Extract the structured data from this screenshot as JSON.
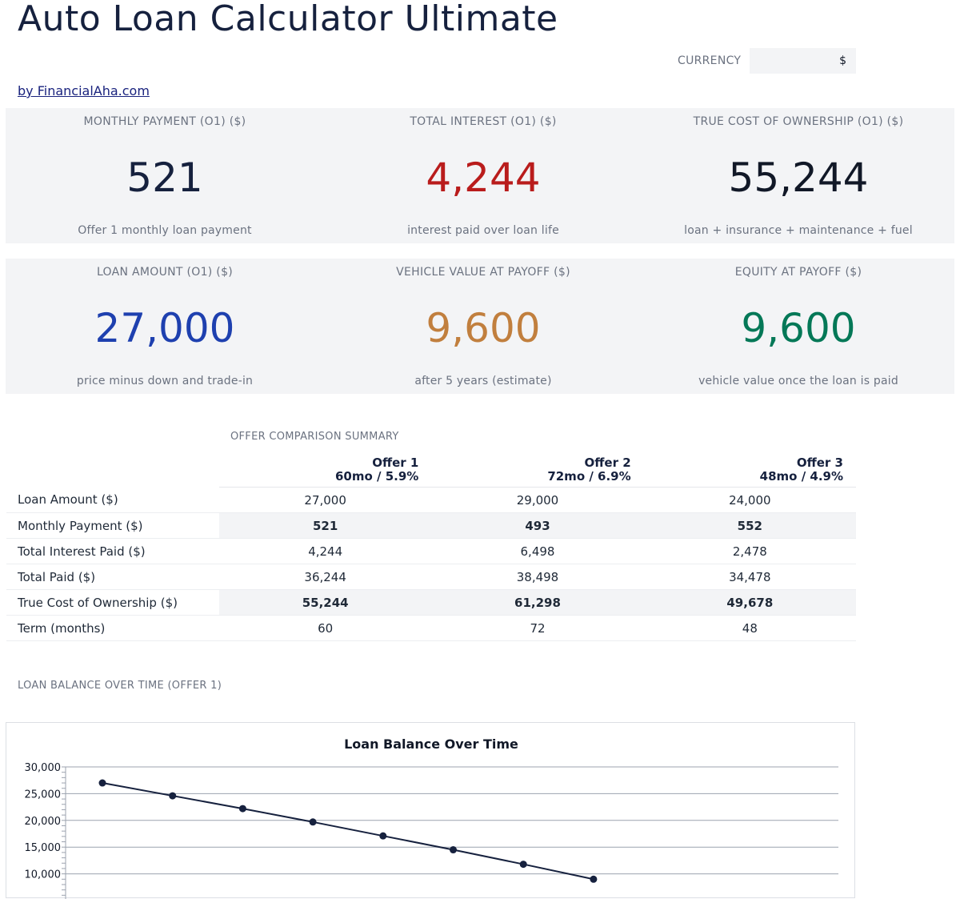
{
  "header": {
    "title": "Auto Loan Calculator Ultimate",
    "byline": "by FinancialAha.com",
    "currency_label": "CURRENCY",
    "currency_value": "$"
  },
  "kpis_row1": [
    {
      "label": "MONTHLY PAYMENT (O1) ($)",
      "value": "521",
      "sub": "Offer 1 monthly loan payment",
      "color": "#16213e"
    },
    {
      "label": "TOTAL INTEREST (O1) ($)",
      "value": "4,244",
      "sub": "interest paid over loan life",
      "color": "#b91c1c"
    },
    {
      "label": "TRUE COST OF OWNERSHIP (O1) ($)",
      "value": "55,244",
      "sub": "loan + insurance + maintenance + fuel",
      "color": "#111827"
    }
  ],
  "kpis_row2": [
    {
      "label": "LOAN AMOUNT (O1) ($)",
      "value": "27,000",
      "sub": "price minus down and trade-in",
      "color": "#1e40af"
    },
    {
      "label": "VEHICLE VALUE AT PAYOFF ($)",
      "value": "9,600",
      "sub": "after 5 years (estimate)",
      "color": "#c17f3e"
    },
    {
      "label": "EQUITY AT PAYOFF ($)",
      "value": "9,600",
      "sub": "vehicle value once the loan is paid",
      "color": "#047857"
    }
  ],
  "comparison": {
    "title": "OFFER COMPARISON SUMMARY",
    "offers": [
      {
        "name": "Offer 1",
        "detail": "60mo / 5.9%"
      },
      {
        "name": "Offer 2",
        "detail": "72mo / 6.9%"
      },
      {
        "name": "Offer 3",
        "detail": "48mo / 4.9%"
      }
    ],
    "rows": [
      {
        "label": "Loan Amount ($)",
        "values": [
          "27,000",
          "29,000",
          "24,000"
        ],
        "highlight": false
      },
      {
        "label": "Monthly Payment ($)",
        "values": [
          "521",
          "493",
          "552"
        ],
        "highlight": true
      },
      {
        "label": "Total Interest Paid ($)",
        "values": [
          "4,244",
          "6,498",
          "2,478"
        ],
        "highlight": false
      },
      {
        "label": "Total Paid ($)",
        "values": [
          "36,244",
          "38,498",
          "34,478"
        ],
        "highlight": false
      },
      {
        "label": "True Cost of Ownership ($)",
        "values": [
          "55,244",
          "61,298",
          "49,678"
        ],
        "highlight": true
      },
      {
        "label": "Term (months)",
        "values": [
          "60",
          "72",
          "48"
        ],
        "highlight": false
      }
    ]
  },
  "balance_section_title": "LOAN BALANCE OVER TIME (OFFER 1)",
  "chart_data": {
    "type": "line",
    "title": "Loan Balance Over Time",
    "xlabel": "",
    "ylabel": "",
    "ylim": [
      0,
      30000
    ],
    "yticks": [
      10000,
      15000,
      20000,
      25000,
      30000
    ],
    "ytick_labels": [
      "10,000",
      "15,000",
      "20,000",
      "25,000",
      "30,000"
    ],
    "grid": true,
    "series": [
      {
        "values": [
          27000,
          24600,
          22200,
          19700,
          17100,
          14500,
          11800,
          9000
        ],
        "color": "#16213e"
      }
    ]
  }
}
